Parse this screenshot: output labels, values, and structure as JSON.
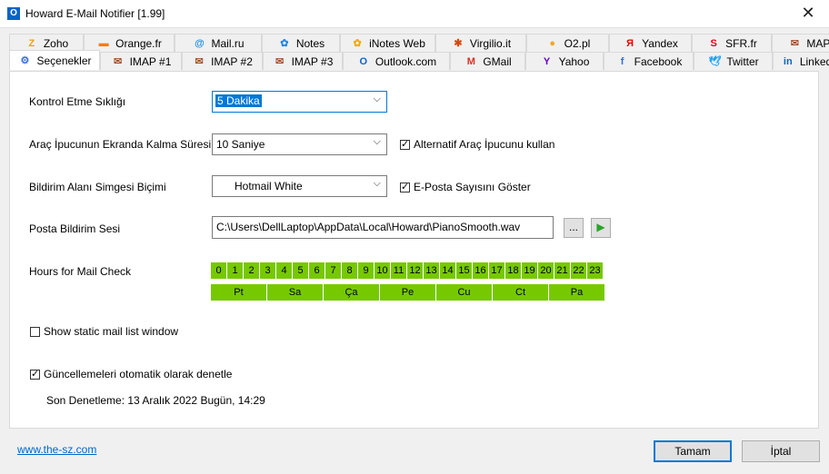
{
  "window": {
    "title": "Howard E-Mail Notifier [1.99]",
    "app_icon_glyph": "O"
  },
  "tabs_row1": [
    {
      "label": "Zoho",
      "icon": "zoho-icon",
      "glyph": "Z",
      "color": "#e8a317"
    },
    {
      "label": "Orange.fr",
      "icon": "orange-icon",
      "glyph": "▬",
      "color": "#ff7900"
    },
    {
      "label": "Mail.ru",
      "icon": "mailru-icon",
      "glyph": "@",
      "color": "#168de2"
    },
    {
      "label": "Notes",
      "icon": "notes-icon",
      "glyph": "✿",
      "color": "#1e88e5"
    },
    {
      "label": "iNotes Web",
      "icon": "inotes-icon",
      "glyph": "✿",
      "color": "#f2a900"
    },
    {
      "label": "Virgilio.it",
      "icon": "virgilio-icon",
      "glyph": "✱",
      "color": "#d9480f"
    },
    {
      "label": "O2.pl",
      "icon": "o2-icon",
      "glyph": "●",
      "color": "#f5a623"
    },
    {
      "label": "Yandex",
      "icon": "yandex-icon",
      "glyph": "Я",
      "color": "#e60000"
    },
    {
      "label": "SFR.fr",
      "icon": "sfr-icon",
      "glyph": "S",
      "color": "#e2001a"
    },
    {
      "label": "MAPI",
      "icon": "mapi-icon",
      "glyph": "✉",
      "color": "#a0522d"
    }
  ],
  "tabs_row2": [
    {
      "label": "Seçenekler",
      "icon": "options-icon",
      "glyph": "⚙",
      "color": "#3a6fd8",
      "active": true
    },
    {
      "label": "IMAP #1",
      "icon": "envelope-icon",
      "glyph": "✉",
      "color": "#a0522d"
    },
    {
      "label": "IMAP #2",
      "icon": "envelope-icon",
      "glyph": "✉",
      "color": "#a0522d"
    },
    {
      "label": "IMAP #3",
      "icon": "envelope-icon",
      "glyph": "✉",
      "color": "#a0522d"
    },
    {
      "label": "Outlook.com",
      "icon": "outlook-icon",
      "glyph": "O",
      "color": "#0a64c8"
    },
    {
      "label": "GMail",
      "icon": "gmail-icon",
      "glyph": "M",
      "color": "#d93025"
    },
    {
      "label": "Yahoo",
      "icon": "yahoo-icon",
      "glyph": "Y",
      "color": "#6001d2"
    },
    {
      "label": "Facebook",
      "icon": "facebook-icon",
      "glyph": "f",
      "color": "#1877f2"
    },
    {
      "label": "Twitter",
      "icon": "twitter-icon",
      "glyph": "🕊",
      "color": "#1da1f2"
    },
    {
      "label": "LinkedIn",
      "icon": "linkedin-icon",
      "glyph": "in",
      "color": "#0a66c2"
    }
  ],
  "settings": {
    "check_freq": {
      "label": "Kontrol Etme Sıklığı",
      "value": "5 Dakika"
    },
    "tooltip_duration": {
      "label": "Araç İpucunun Ekranda Kalma Süresi",
      "value": "10 Saniye",
      "alt_checkbox": "Alternatif Araç İpucunu kullan",
      "alt_checked": true
    },
    "tray_icon": {
      "label": "Bildirim Alanı Simgesi Biçimi",
      "value": "Hotmail White",
      "count_checkbox": "E-Posta Sayısını Göster",
      "count_checked": true
    },
    "sound": {
      "label": "Posta Bildirim Sesi",
      "path": "C:\\Users\\DellLaptop\\AppData\\Local\\Howard\\PianoSmooth.wav",
      "browse_label": "...",
      "play_glyph": "▶"
    },
    "hours": {
      "label": "Hours for Mail Check",
      "values": [
        "0",
        "1",
        "2",
        "3",
        "4",
        "5",
        "6",
        "7",
        "8",
        "9",
        "10",
        "11",
        "12",
        "13",
        "14",
        "15",
        "16",
        "17",
        "18",
        "19",
        "20",
        "21",
        "22",
        "23"
      ],
      "days": [
        "Pt",
        "Sa",
        "Ça",
        "Pe",
        "Cu",
        "Ct",
        "Pa"
      ],
      "active_color": "#76c900"
    },
    "static_list": {
      "label": "Show static mail list window",
      "checked": false
    },
    "auto_update": {
      "label": "Güncellemeleri otomatik olarak denetle",
      "checked": true
    },
    "last_check": "Son Denetleme: 13 Aralık 2022 Bugün, 14:29"
  },
  "footer": {
    "link": "www.the-sz.com",
    "ok_label": "Tamam",
    "cancel_label": "İptal"
  }
}
